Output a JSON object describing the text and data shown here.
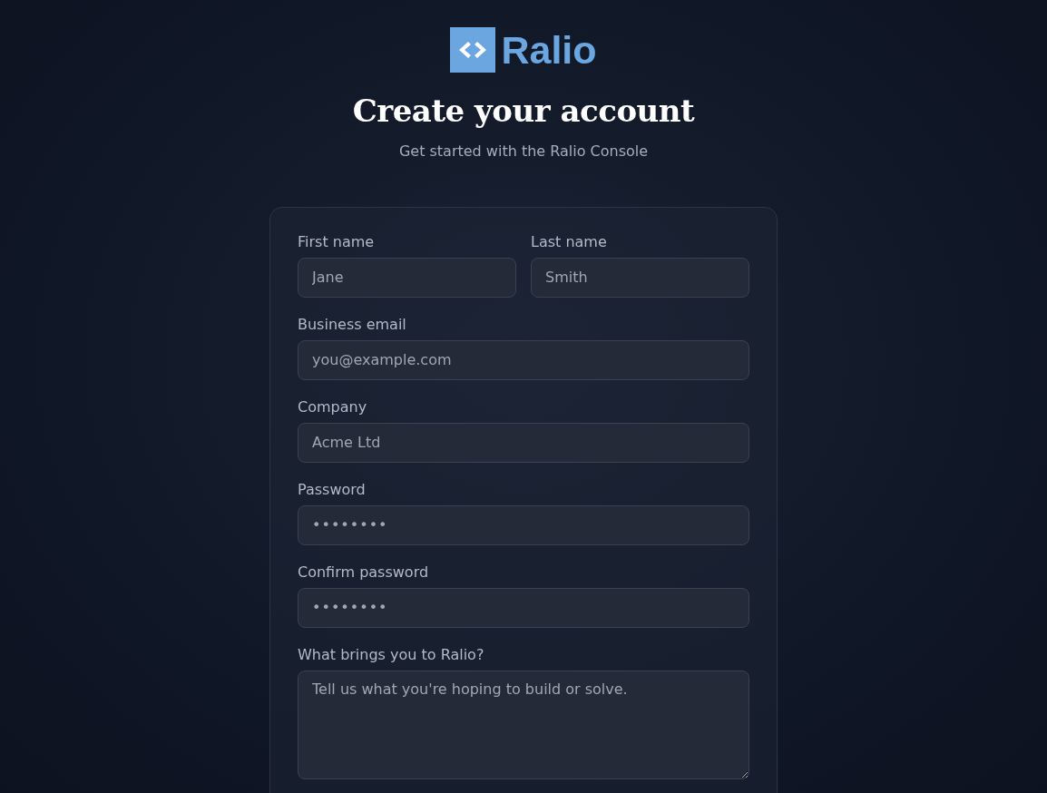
{
  "brand": {
    "name": "Ralio"
  },
  "heading": {
    "title": "Create your account",
    "subtitle": "Get started with the Ralio Console"
  },
  "form": {
    "rows": [
      [
        {
          "kind": "text",
          "label": "First name",
          "placeholder": "Jane"
        },
        {
          "kind": "text",
          "label": "Last name",
          "placeholder": "Smith"
        }
      ],
      [
        {
          "kind": "email",
          "label": "Business email",
          "placeholder": "you@example.com"
        }
      ],
      [
        {
          "kind": "text",
          "label": "Company",
          "placeholder": "Acme Ltd"
        }
      ],
      [
        {
          "kind": "password",
          "label": "Password",
          "placeholder": "••••••••"
        }
      ],
      [
        {
          "kind": "password",
          "label": "Confirm password",
          "placeholder": "••••••••"
        }
      ],
      [
        {
          "kind": "textarea",
          "label": "What brings you to Ralio?",
          "placeholder": "Tell us what you're hoping to build or solve."
        }
      ]
    ]
  }
}
